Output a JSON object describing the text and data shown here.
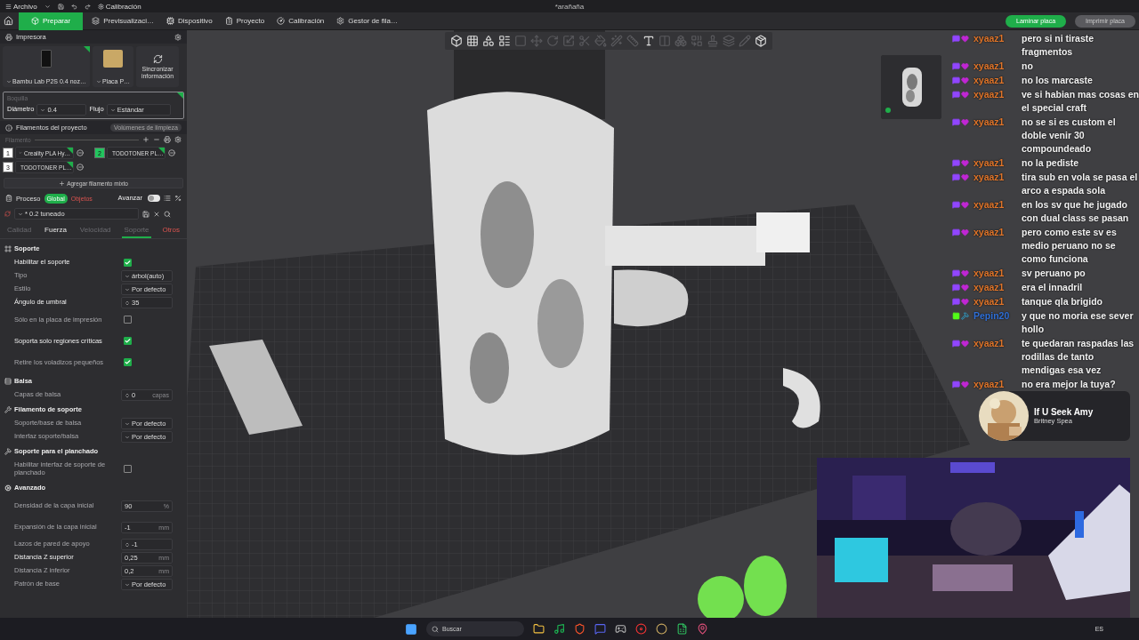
{
  "titlebar": {
    "menu": "Archivo",
    "calibration": "Calibración",
    "title": "*arañaña"
  },
  "tabs": [
    {
      "label": "Preparar",
      "selected": true
    },
    {
      "label": "Previsualizaci…",
      "selected": false
    },
    {
      "label": "Dispositivo",
      "selected": false
    },
    {
      "label": "Proyecto",
      "selected": false
    },
    {
      "label": "Calibración",
      "selected": false
    },
    {
      "label": "Gestor de fila…",
      "selected": false
    }
  ],
  "actions": [
    {
      "label": "Laminar placa",
      "kind": "primary"
    },
    {
      "label": "Imprimir placa",
      "kind": "secondary"
    }
  ],
  "printer": {
    "title": "Impresora",
    "printer_name": "Bambu Lab P2S 0.4 noz…",
    "plate_name": "Placa P…",
    "sync": "Sincronizar información",
    "nozzle": {
      "title": "Boquilla",
      "diameter_label": "Diámetro",
      "diameter": "0.4",
      "flow_label": "Flujo",
      "flow": "Estándar"
    }
  },
  "filaments": {
    "title": "Filamentos del proyecto",
    "flush": "Volúmenes de limpieza",
    "label": "Filamento",
    "add_mixed": "Agregar filamento mixto",
    "items": [
      {
        "number": "1",
        "name": "Creality PLA Hy…",
        "color": "#ffffff"
      },
      {
        "number": "2",
        "name": "TODOTONER PL…",
        "color": "#22c55e"
      },
      {
        "number": "3",
        "name": "TODOTONER PL…",
        "color": "#ffffff"
      }
    ]
  },
  "process": {
    "title": "Proceso",
    "scopes": [
      {
        "label": "Global",
        "selected": true
      },
      {
        "label": "Objetos",
        "selected": false
      }
    ],
    "advanced_label": "Avanzar",
    "advanced_on": false,
    "preset": "* 0.2 tuneado",
    "tabs": [
      {
        "label": "Calidad",
        "selected": false,
        "kind": "default"
      },
      {
        "label": "Fuerza",
        "selected": false,
        "kind": "modified"
      },
      {
        "label": "Velocidad",
        "selected": false,
        "kind": "default"
      },
      {
        "label": "Soporte",
        "selected": true,
        "kind": "default"
      },
      {
        "label": "Otros",
        "selected": false,
        "kind": "error"
      }
    ]
  },
  "settings": [
    {
      "title": "Soporte",
      "kind": "support",
      "rows": [
        {
          "label": "Habilitar el soporte",
          "kind": "checkbox",
          "checked": true,
          "modified": true
        },
        {
          "label": "Tipo",
          "kind": "select",
          "value": "árbol(auto)",
          "modified": false
        },
        {
          "label": "Estilo",
          "kind": "select",
          "value": "Por defecto",
          "modified": false
        },
        {
          "label": "Ángulo de umbral",
          "kind": "spin",
          "value": "35",
          "modified": true
        },
        {
          "label": "Sólo en la placa de impresión",
          "kind": "checkbox",
          "checked": false,
          "modified": false
        },
        {
          "label": "Soporta solo regiones críticas",
          "kind": "checkbox",
          "checked": true,
          "modified": true
        },
        {
          "label": "Retire los voladizos pequeños",
          "kind": "checkbox",
          "checked": true,
          "modified": false
        }
      ]
    },
    {
      "title": "Balsa",
      "kind": "raft",
      "rows": [
        {
          "label": "Capas de balsa",
          "kind": "spin",
          "value": "0",
          "unit": "capas",
          "modified": false
        }
      ]
    },
    {
      "title": "Filamento de soporte",
      "kind": "filament",
      "rows": [
        {
          "label": "Soporte/base de balsa",
          "kind": "select",
          "value": "Por defecto",
          "modified": false
        },
        {
          "label": "Interfaz soporte/balsa",
          "kind": "select",
          "value": "Por defecto",
          "modified": false
        }
      ]
    },
    {
      "title": "Soporte para el planchado",
      "kind": "ironing",
      "rows": [
        {
          "label": "Habilitar interfaz de soporte de planchado",
          "kind": "checkbox",
          "checked": false,
          "modified": false
        }
      ]
    },
    {
      "title": "Avanzado",
      "kind": "advanced",
      "rows": [
        {
          "label": "Densidad de la capa inicial",
          "kind": "input",
          "value": "90",
          "unit": "%",
          "modified": false
        },
        {
          "label": "Expansión de la capa inicial",
          "kind": "input",
          "value": "-1",
          "unit": "mm",
          "modified": false
        },
        {
          "label": "Lazos de pared de apoyo",
          "kind": "spin",
          "value": "-1",
          "modified": false
        },
        {
          "label": "Distancia Z superior",
          "kind": "input",
          "value": "0,25",
          "unit": "mm",
          "modified": true
        },
        {
          "label": "Distancia Z inferior",
          "kind": "input",
          "value": "0,2",
          "unit": "mm",
          "modified": false
        },
        {
          "label": "Patrón de base",
          "kind": "select",
          "value": "Por defecto",
          "modified": false
        }
      ]
    }
  ],
  "toolbar": [
    {
      "kind": "add-cube",
      "disabled": false
    },
    {
      "kind": "add-grid",
      "disabled": false
    },
    {
      "kind": "arrange",
      "disabled": false
    },
    {
      "kind": "plates",
      "disabled": false
    },
    {
      "kind": "layout",
      "disabled": true
    },
    {
      "kind": "move",
      "disabled": true
    },
    {
      "kind": "rotate",
      "disabled": true
    },
    {
      "kind": "scale",
      "disabled": true
    },
    {
      "kind": "cut",
      "disabled": true
    },
    {
      "kind": "paint",
      "disabled": true
    },
    {
      "kind": "seam",
      "disabled": true
    },
    {
      "kind": "measure",
      "disabled": true
    },
    {
      "kind": "text",
      "disabled": false
    },
    {
      "kind": "split",
      "disabled": true
    },
    {
      "kind": "mesh",
      "disabled": true
    },
    {
      "kind": "boolean",
      "disabled": true
    },
    {
      "kind": "emboss",
      "disabled": true
    },
    {
      "kind": "layers",
      "disabled": true
    },
    {
      "kind": "pencil",
      "disabled": true
    },
    {
      "kind": "assembly",
      "disabled": false
    }
  ],
  "chat": [
    {
      "user": "xyaaz1",
      "kind": "twitch",
      "color": "#e0752a",
      "text": "pero si ni tiraste fragmentos"
    },
    {
      "user": "xyaaz1",
      "kind": "twitch",
      "color": "#e0752a",
      "text": "no"
    },
    {
      "user": "xyaaz1",
      "kind": "twitch",
      "color": "#e0752a",
      "text": "no los marcaste"
    },
    {
      "user": "xyaaz1",
      "kind": "twitch",
      "color": "#e0752a",
      "text": "ve si habian mas cosas en el special craft"
    },
    {
      "user": "xyaaz1",
      "kind": "twitch",
      "color": "#e0752a",
      "text": "no se si es custom el doble venir 30 compoundeado"
    },
    {
      "user": "xyaaz1",
      "kind": "twitch",
      "color": "#e0752a",
      "text": "no la pediste"
    },
    {
      "user": "xyaaz1",
      "kind": "twitch",
      "color": "#e0752a",
      "text": "tira sub en vola se pasa el arco a espada sola"
    },
    {
      "user": "xyaaz1",
      "kind": "twitch",
      "color": "#e0752a",
      "text": "en los sv que he jugado con dual class se pasan"
    },
    {
      "user": "xyaaz1",
      "kind": "twitch",
      "color": "#e0752a",
      "text": "pero como este sv es medio peruano no se como funciona"
    },
    {
      "user": "xyaaz1",
      "kind": "twitch",
      "color": "#e0752a",
      "text": "sv peruano po"
    },
    {
      "user": "xyaaz1",
      "kind": "twitch",
      "color": "#e0752a",
      "text": "era el innadril"
    },
    {
      "user": "xyaaz1",
      "kind": "twitch",
      "color": "#e0752a",
      "text": "tanque qla brigido"
    },
    {
      "user": "Pepin20",
      "kind": "kick",
      "color": "#2f6fd6",
      "text": "y que no moria ese sever hollo"
    },
    {
      "user": "xyaaz1",
      "kind": "twitch",
      "color": "#e0752a",
      "text": "te quedaran raspadas las rodillas de tanto mendigas esa vez"
    },
    {
      "user": "xyaaz1",
      "kind": "twitch",
      "color": "#e0752a",
      "text": "no era mejor la tuya?"
    }
  ],
  "now_playing": {
    "title": "If U Seek Amy",
    "artist": "Britney Spea"
  },
  "taskbar": {
    "search": "Buscar",
    "language": "ES"
  }
}
